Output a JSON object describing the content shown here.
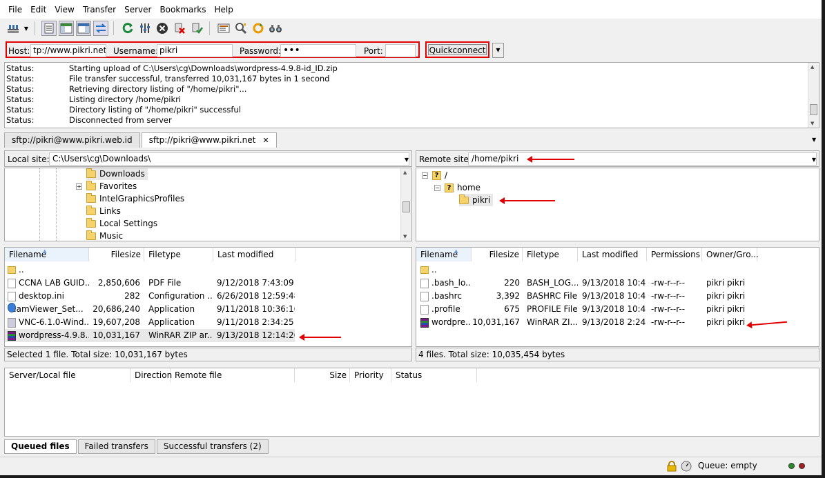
{
  "menu": [
    "File",
    "Edit",
    "View",
    "Transfer",
    "Server",
    "Bookmarks",
    "Help"
  ],
  "toolbar_icons": [
    "site-manager-icon",
    "dropdown-icon",
    "toggle-log-icon",
    "toggle-local-tree-icon",
    "toggle-remote-tree-icon",
    "toggle-queue-icon",
    "refresh-icon",
    "process-queue-icon",
    "cancel-icon",
    "disconnect-icon",
    "reconnect-icon",
    "filter-icon",
    "compare-icon",
    "sync-browse-icon",
    "search-icon"
  ],
  "quickconnect": {
    "host_label": "Host:",
    "host_value": "tp://www.pikri.net",
    "username_label": "Username:",
    "username_value": "pikri",
    "password_label": "Password:",
    "password_value": "•••",
    "port_label": "Port:",
    "port_value": "",
    "button": "Quickconnect"
  },
  "log": [
    {
      "k": "Status:",
      "v": "Starting upload of C:\\Users\\cg\\Downloads\\wordpress-4.9.8-id_ID.zip"
    },
    {
      "k": "Status:",
      "v": "File transfer successful, transferred 10,031,167 bytes in 1 second"
    },
    {
      "k": "Status:",
      "v": "Retrieving directory listing of \"/home/pikri\"..."
    },
    {
      "k": "Status:",
      "v": "Listing directory /home/pikri"
    },
    {
      "k": "Status:",
      "v": "Directory listing of \"/home/pikri\" successful"
    },
    {
      "k": "Status:",
      "v": "Disconnected from server"
    }
  ],
  "tabs": [
    {
      "label": "sftp://pikri@www.pikri.web.id",
      "active": false
    },
    {
      "label": "sftp://pikri@www.pikri.net",
      "active": true,
      "close": "✕"
    }
  ],
  "local": {
    "site_label": "Local site:",
    "path": "C:\\Users\\cg\\Downloads\\",
    "tree": [
      "Downloads",
      "Favorites",
      "IntelGraphicsProfiles",
      "Links",
      "Local Settings",
      "Music"
    ],
    "headers": [
      "Filename",
      "Filesize",
      "Filetype",
      "Last modified"
    ],
    "files": [
      {
        "name": "..",
        "size": "",
        "type": "",
        "modified": "",
        "icon": "folder"
      },
      {
        "name": "CCNA LAB GUID...",
        "size": "2,850,606",
        "type": "PDF File",
        "modified": "9/12/2018 7:43:09 ...",
        "icon": "file"
      },
      {
        "name": "desktop.ini",
        "size": "282",
        "type": "Configuration ...",
        "modified": "6/26/2018 12:59:48...",
        "icon": "file"
      },
      {
        "name": "TeamViewer_Set...",
        "size": "20,686,240",
        "type": "Application",
        "modified": "9/11/2018 10:36:16...",
        "icon": "app"
      },
      {
        "name": "VNC-6.1.0-Wind...",
        "size": "19,607,208",
        "type": "Application",
        "modified": "9/11/2018 2:34:25 ...",
        "icon": "app"
      },
      {
        "name": "wordpress-4.9.8...",
        "size": "10,031,167",
        "type": "WinRAR ZIP ar...",
        "modified": "9/13/2018 12:14:26...",
        "icon": "zip"
      }
    ],
    "status": "Selected 1 file. Total size: 10,031,167 bytes"
  },
  "remote": {
    "site_label": "Remote site:",
    "path": "/home/pikri",
    "tree": [
      "/",
      "home",
      "pikri"
    ],
    "headers": [
      "Filename",
      "Filesize",
      "Filetype",
      "Last modified",
      "Permissions",
      "Owner/Gro..."
    ],
    "files": [
      {
        "name": "..",
        "size": "",
        "type": "",
        "modified": "",
        "perm": "",
        "owner": "",
        "icon": "folder"
      },
      {
        "name": ".bash_lo...",
        "size": "220",
        "type": "BASH_LOG...",
        "modified": "9/13/2018 10:4...",
        "perm": "-rw-r--r--",
        "owner": "pikri pikri",
        "icon": "file"
      },
      {
        "name": ".bashrc",
        "size": "3,392",
        "type": "BASHRC File",
        "modified": "9/13/2018 10:4...",
        "perm": "-rw-r--r--",
        "owner": "pikri pikri",
        "icon": "file"
      },
      {
        "name": ".profile",
        "size": "675",
        "type": "PROFILE File",
        "modified": "9/13/2018 10:4...",
        "perm": "-rw-r--r--",
        "owner": "pikri pikri",
        "icon": "file"
      },
      {
        "name": "wordpre...",
        "size": "10,031,167",
        "type": "WinRAR ZI...",
        "modified": "9/13/2018 2:24:...",
        "perm": "-rw-r--r--",
        "owner": "pikri pikri",
        "icon": "zip"
      }
    ],
    "status": "4 files. Total size: 10,035,454 bytes"
  },
  "queue": {
    "headers": [
      "Server/Local file",
      "Direction",
      "Remote file",
      "Size",
      "Priority",
      "Status"
    ],
    "tabs": [
      "Queued files",
      "Failed transfers",
      "Successful transfers (2)"
    ],
    "status": "Queue: empty"
  },
  "colors": {
    "highlight": "#e00000",
    "folder": "#f5d26a"
  }
}
